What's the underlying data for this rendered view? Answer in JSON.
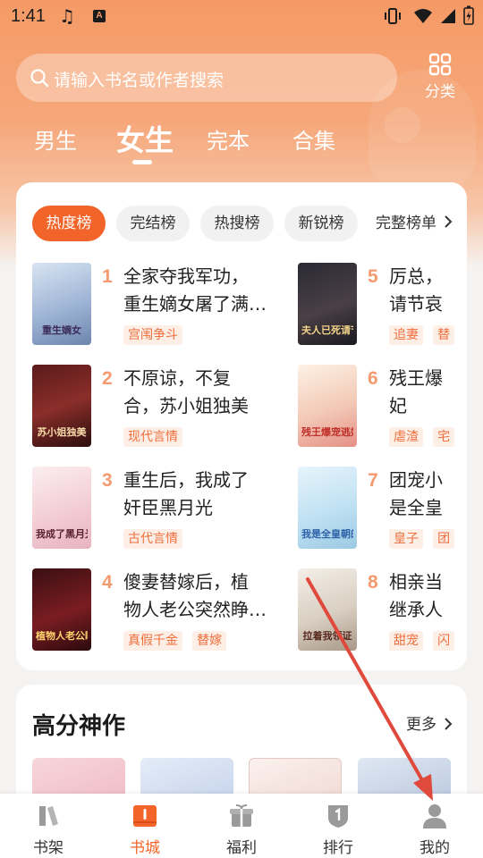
{
  "status_bar": {
    "time": "1:41",
    "input_method_icon": "A"
  },
  "search": {
    "placeholder": "请输入书名或作者搜索"
  },
  "category": {
    "label": "分类"
  },
  "main_tabs": [
    {
      "label": "男生",
      "active": false
    },
    {
      "label": "女生",
      "active": true
    },
    {
      "label": "完本",
      "active": false
    },
    {
      "label": "合集",
      "active": false
    }
  ],
  "rank_chips": [
    {
      "label": "热度榜",
      "active": true
    },
    {
      "label": "完结榜",
      "active": false
    },
    {
      "label": "热搜榜",
      "active": false
    },
    {
      "label": "新锐榜",
      "active": false
    },
    {
      "label": "完整榜单",
      "active": false
    }
  ],
  "books": [
    {
      "rank": "1",
      "title_line1": "全家夺我军功，",
      "title_line2": "重生嫡女屠了满…",
      "tags": [
        "宫闱争斗"
      ],
      "cover_text": "重生嫡女"
    },
    {
      "rank": "2",
      "title_line1": "不原谅，不复",
      "title_line2": "合，苏小姐独美",
      "tags": [
        "现代言情"
      ],
      "cover_text": "苏小姐独美"
    },
    {
      "rank": "3",
      "title_line1": "重生后，我成了",
      "title_line2": "奸臣黑月光",
      "tags": [
        "古代言情"
      ],
      "cover_text": "我成了黑月光"
    },
    {
      "rank": "4",
      "title_line1": "傻妻替嫁后，植",
      "title_line2": "物人老公突然睁…",
      "tags": [
        "真假千金",
        "替嫁"
      ],
      "cover_text": "植物人老公睁开眼"
    },
    {
      "rank": "5",
      "title_line1": "厉总，",
      "title_line2": "请节哀",
      "tags": [
        "追妻",
        "替"
      ],
      "cover_text": "夫人已死请节哀"
    },
    {
      "rank": "6",
      "title_line1": "残王爆",
      "title_line2": "妃",
      "tags": [
        "虐渣",
        "宅"
      ],
      "cover_text": "残王爆宠逃妃"
    },
    {
      "rank": "7",
      "title_line1": "团宠小",
      "title_line2": "是全皇",
      "tags": [
        "皇子",
        "团"
      ],
      "cover_text": "我是全皇朝的宝"
    },
    {
      "rank": "8",
      "title_line1": "相亲当",
      "title_line2": "继承人",
      "tags": [
        "甜宠",
        "闪"
      ],
      "cover_text": "拉着我领证"
    }
  ],
  "high_score": {
    "title": "高分神作",
    "more": "更多"
  },
  "bottom_nav": [
    {
      "label": "书架",
      "icon": "bookshelf-icon",
      "active": false
    },
    {
      "label": "书城",
      "icon": "bookstore-icon",
      "active": true
    },
    {
      "label": "福利",
      "icon": "gift-icon",
      "active": false
    },
    {
      "label": "排行",
      "icon": "ranking-icon",
      "active": false
    },
    {
      "label": "我的",
      "icon": "profile-icon",
      "active": false
    }
  ],
  "colors": {
    "accent": "#f2642a",
    "header": "#f59a66",
    "rank_number": "#f39a6f",
    "tag_text": "#ee6f3d",
    "annotation": "#e04a3c"
  }
}
